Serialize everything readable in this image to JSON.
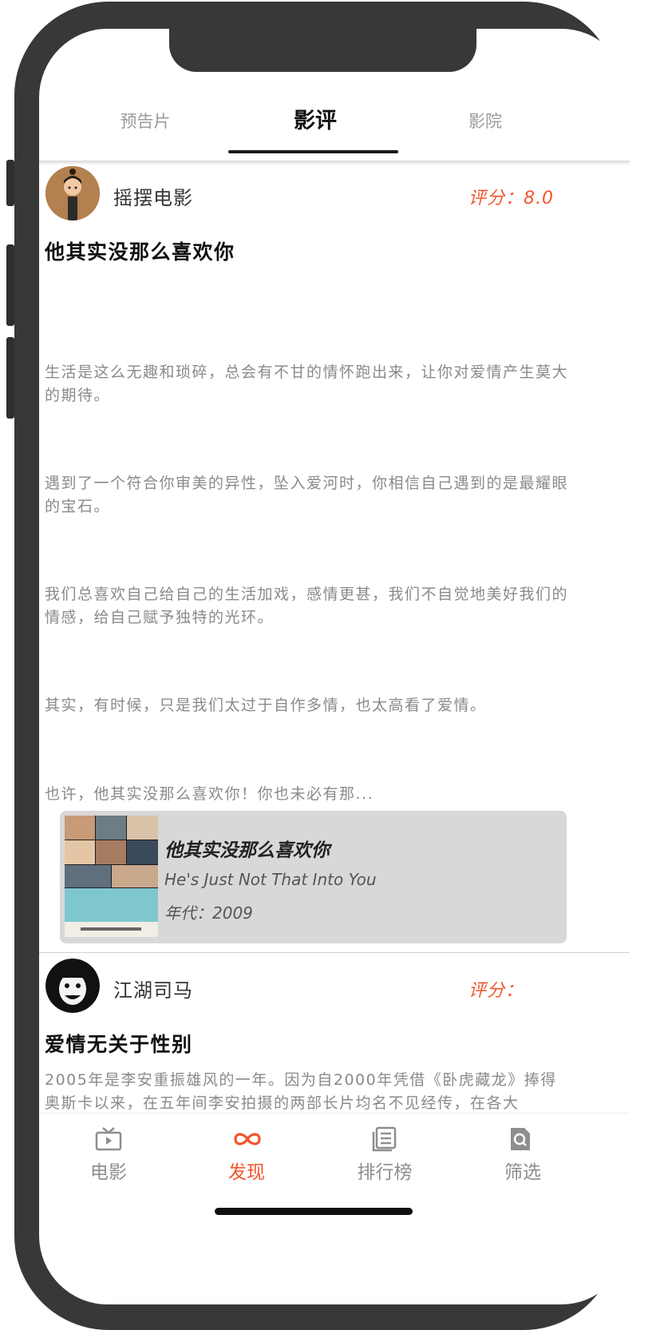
{
  "tabs": [
    {
      "label": "预告片",
      "active": false
    },
    {
      "label": "影评",
      "active": true
    },
    {
      "label": "影院",
      "active": false
    }
  ],
  "reviews": [
    {
      "author": "摇摆电影",
      "score_text": "评分：8.0",
      "title": "他其实没那么喜欢你",
      "paragraphs": [
        "生活是这么无趣和琐碎，总会有不甘的情怀跑出来，让你对爱情产生莫大的期待。",
        "遇到了一个符合你审美的异性，坠入爱河时，你相信自己遇到的是最耀眼的宝石。",
        "我们总喜欢自己给自己的生活加戏，感情更甚，我们不自觉地美好我们的情感，给自己赋予独特的光环。",
        "其实，有时候，只是我们太过于自作多情，也太高看了爱情。",
        "也许，他其实没那么喜欢你！你也未必有那..."
      ],
      "movie": {
        "title": "他其实没那么喜欢你",
        "original_title": "He's Just Not That Into You",
        "year_text": "年代：2009"
      }
    },
    {
      "author": "江湖司马",
      "score_text": "评分：",
      "title": "爱情无关于性别",
      "paragraphs": [
        "2005年是李安重振雄风的一年。因为自2000年凭借《卧虎藏龙》捧得奥斯卡以来，在五年间李安拍摄的两部长片均名不见经传，在各大"
      ]
    }
  ],
  "bottom_nav": [
    {
      "label": "电影",
      "icon": "tv-icon",
      "active": false
    },
    {
      "label": "发现",
      "icon": "infinity-icon",
      "active": true
    },
    {
      "label": "排行榜",
      "icon": "list-icon",
      "active": false
    },
    {
      "label": "筛选",
      "icon": "search-doc-icon",
      "active": false
    }
  ],
  "colors": {
    "accent": "#f2552c",
    "frame": "#383838",
    "card": "#d8d8d8"
  }
}
